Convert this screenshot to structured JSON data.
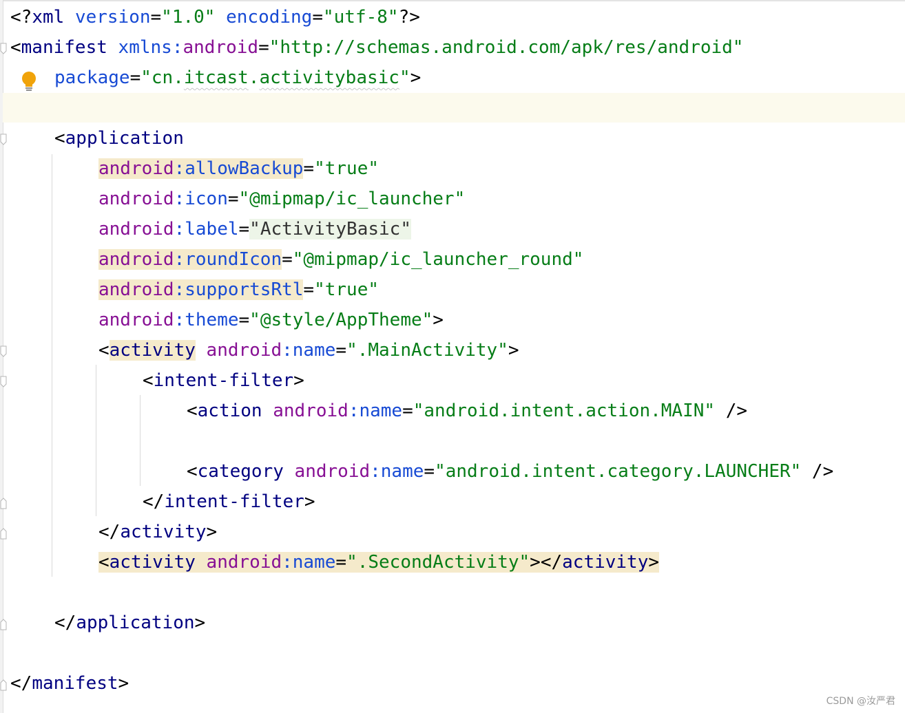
{
  "editor": {
    "lines": {
      "xml_decl": [
        "<?",
        "xml",
        " ",
        "version",
        "=",
        "\"1.0\"",
        " ",
        "encoding",
        "=",
        "\"utf-8\"",
        "?>"
      ],
      "manifest_open": [
        "<",
        "manifest",
        " ",
        "xmlns",
        ":",
        "android",
        "=",
        "\"http://schemas.android.com/apk/res/android\""
      ],
      "package": [
        "package",
        "=",
        "\"",
        "cn",
        ".",
        "itcast",
        ".",
        "activitybasic",
        "\"",
        ">"
      ],
      "application_open": [
        "<",
        "application"
      ],
      "allow_backup": [
        "android",
        ":",
        "allowBackup",
        "=",
        "\"true\""
      ],
      "icon": [
        "android",
        ":",
        "icon",
        "=",
        "\"@mipmap/ic_launcher\""
      ],
      "label": [
        "android",
        ":",
        "label",
        "=",
        "\"ActivityBasic\""
      ],
      "round_icon": [
        "android",
        ":",
        "roundIcon",
        "=",
        "\"@mipmap/ic_launcher_round\""
      ],
      "supports_rtl": [
        "android",
        ":",
        "supportsRtl",
        "=",
        "\"true\""
      ],
      "theme": [
        "android",
        ":",
        "theme",
        "=",
        "\"@style/AppTheme\"",
        ">"
      ],
      "activity_main": [
        "<",
        "activity",
        " ",
        "android",
        ":",
        "name",
        "=",
        "\".MainActivity\"",
        ">"
      ],
      "intent_filter_open": [
        "<",
        "intent-filter",
        ">"
      ],
      "action": [
        "<",
        "action",
        " ",
        "android",
        ":",
        "name",
        "=",
        "\"android.intent.action.MAIN\"",
        " />"
      ],
      "category": [
        "<",
        "category",
        " ",
        "android",
        ":",
        "name",
        "=",
        "\"android.intent.category.LAUNCHER\"",
        " />"
      ],
      "intent_filter_close": [
        "</",
        "intent-filter",
        ">"
      ],
      "activity_close": [
        "</",
        "activity",
        ">"
      ],
      "activity_second": [
        "<",
        "activity",
        " ",
        "android",
        ":",
        "name",
        "=",
        "\".SecondActivity\"",
        "></",
        "activity",
        ">"
      ],
      "application_close": [
        "</",
        "application",
        ">"
      ],
      "manifest_close": [
        "</",
        "manifest",
        ">"
      ]
    },
    "icons": {
      "intention": "lightbulb-icon"
    },
    "colors": {
      "tag": "#000080",
      "namespace": "#871094",
      "attribute": "#174ad4",
      "value": "#067d17",
      "caret_row": "#fcfaed",
      "highlight": "#f5eacb",
      "lightbulb": "#f0a30a"
    }
  },
  "watermark": "CSDN @汝严君"
}
